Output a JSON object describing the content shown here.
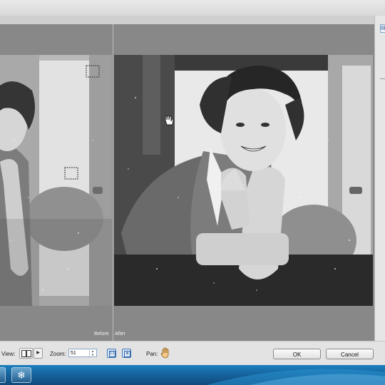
{
  "preview": {
    "before_label": "Before",
    "after_label": "After"
  },
  "right_panel": {
    "tab_icon": "layers-tab-icon"
  },
  "bottom_bar": {
    "view_label": "View:",
    "view_icon": "split-view-icon",
    "zoom_label": "Zoom:",
    "zoom_value": "51",
    "actual_pixels_icon": "one-to-one-icon",
    "fit_icon": "fit-screen-icon",
    "pan_label": "Pan:",
    "pan_icon": "hand-icon",
    "ok_label": "OK",
    "cancel_label": "Cancel"
  },
  "taskbar": {
    "app_icon": "snowflake-icon"
  },
  "colors": {
    "preview_bg": "#888888",
    "taskbar": "#1b6fad",
    "toolbar": "#e3e3e3"
  }
}
